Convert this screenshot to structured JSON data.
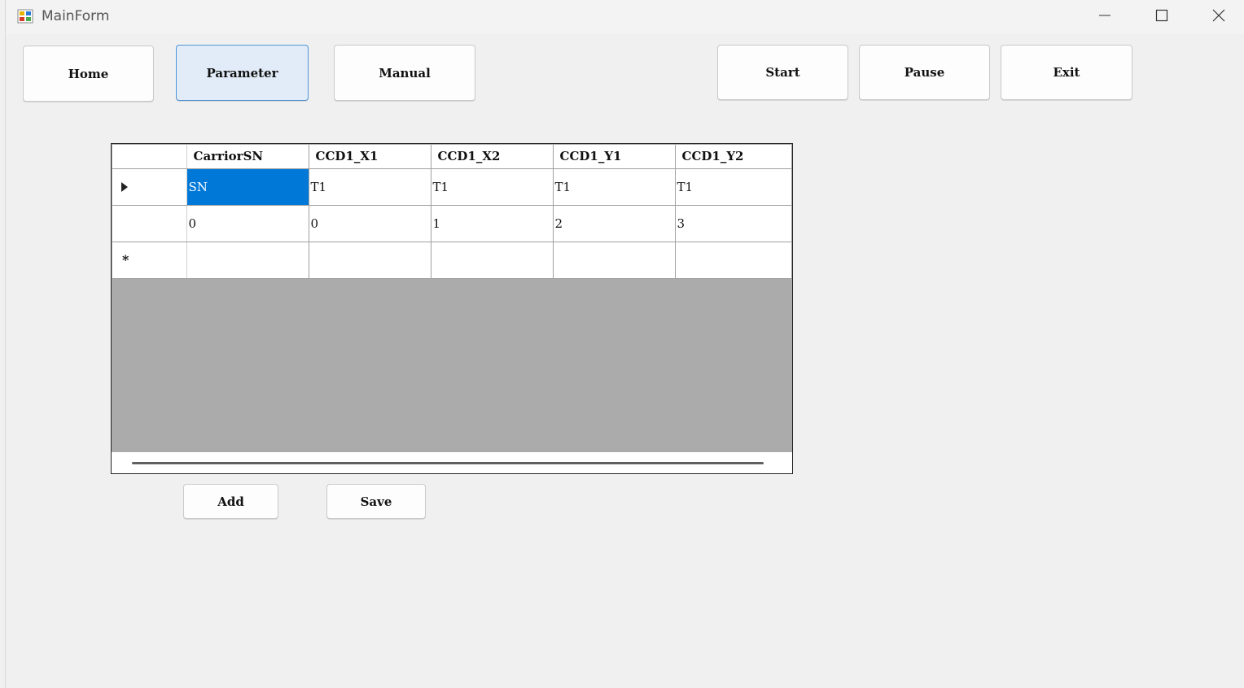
{
  "window": {
    "title": "MainForm",
    "icons": {
      "app": "app-form-icon",
      "minimize": "minimize-icon",
      "maximize": "maximize-icon",
      "close": "close-icon"
    }
  },
  "nav": {
    "home": "Home",
    "parameter": "Parameter",
    "manual": "Manual"
  },
  "controls": {
    "start": "Start",
    "pause": "Pause",
    "exit": "Exit"
  },
  "grid": {
    "columns": [
      "CarriorSN",
      "CCD1_X1",
      "CCD1_X2",
      "CCD1_Y1",
      "CCD1_Y2"
    ],
    "rows": [
      [
        "SN",
        "T1",
        "T1",
        "T1",
        "T1"
      ],
      [
        "0",
        "0",
        "1",
        "2",
        "3"
      ],
      [
        "",
        "",
        "",
        "",
        ""
      ]
    ],
    "current_row_marker": "current-row-arrow-icon",
    "new_row_marker": "*",
    "selected_cell_color": "#0078d7"
  },
  "actions": {
    "add": "Add",
    "save": "Save"
  },
  "colors": {
    "accent": "#0078d7",
    "active_tab_bg": "#e1ecf8",
    "active_tab_border": "#4f94d4"
  }
}
